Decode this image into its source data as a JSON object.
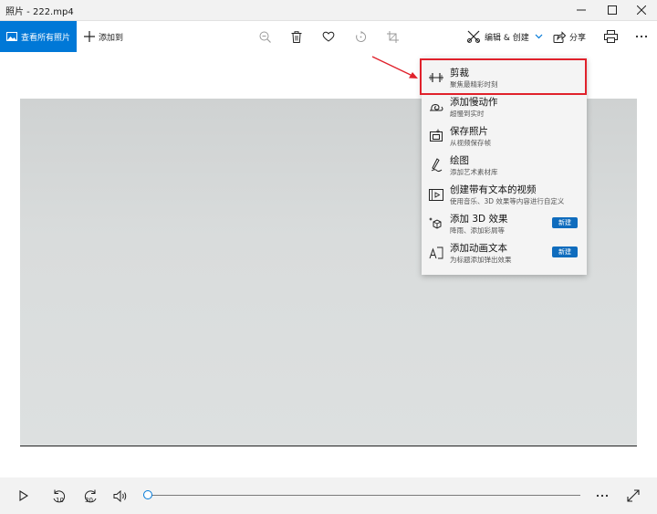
{
  "window": {
    "title": "照片 - 222.mp4"
  },
  "toolbar": {
    "view_all_label": "查看所有照片",
    "add_to_label": "添加到",
    "edit_create_label": "编辑 & 创建",
    "share_label": "分享"
  },
  "menu": {
    "items": [
      {
        "title": "剪裁",
        "subtitle": "聚焦最精彩时刻",
        "icon": "trim-icon",
        "badge": ""
      },
      {
        "title": "添加慢动作",
        "subtitle": "超慢到实时",
        "icon": "snail-icon",
        "badge": ""
      },
      {
        "title": "保存照片",
        "subtitle": "从视频保存帧",
        "icon": "save-photo-icon",
        "badge": ""
      },
      {
        "title": "绘图",
        "subtitle": "添加艺术素材库",
        "icon": "pen-icon",
        "badge": ""
      },
      {
        "title": "创建带有文本的视频",
        "subtitle": "使用音乐、3D 效果等内容进行自定义",
        "icon": "video-text-icon",
        "badge": ""
      },
      {
        "title": "添加 3D 效果",
        "subtitle": "降雨、添加彩屑等",
        "icon": "3d-effects-icon",
        "badge": "新建"
      },
      {
        "title": "添加动画文本",
        "subtitle": "为标题添加弹出效果",
        "icon": "animated-text-icon",
        "badge": "新建"
      }
    ]
  },
  "player": {
    "rewind_seconds": "10",
    "forward_seconds": "30",
    "progress": 0.0
  },
  "colors": {
    "accent": "#0078d7",
    "highlight_border": "#e0212b",
    "new_badge": "#0f6cbd"
  }
}
